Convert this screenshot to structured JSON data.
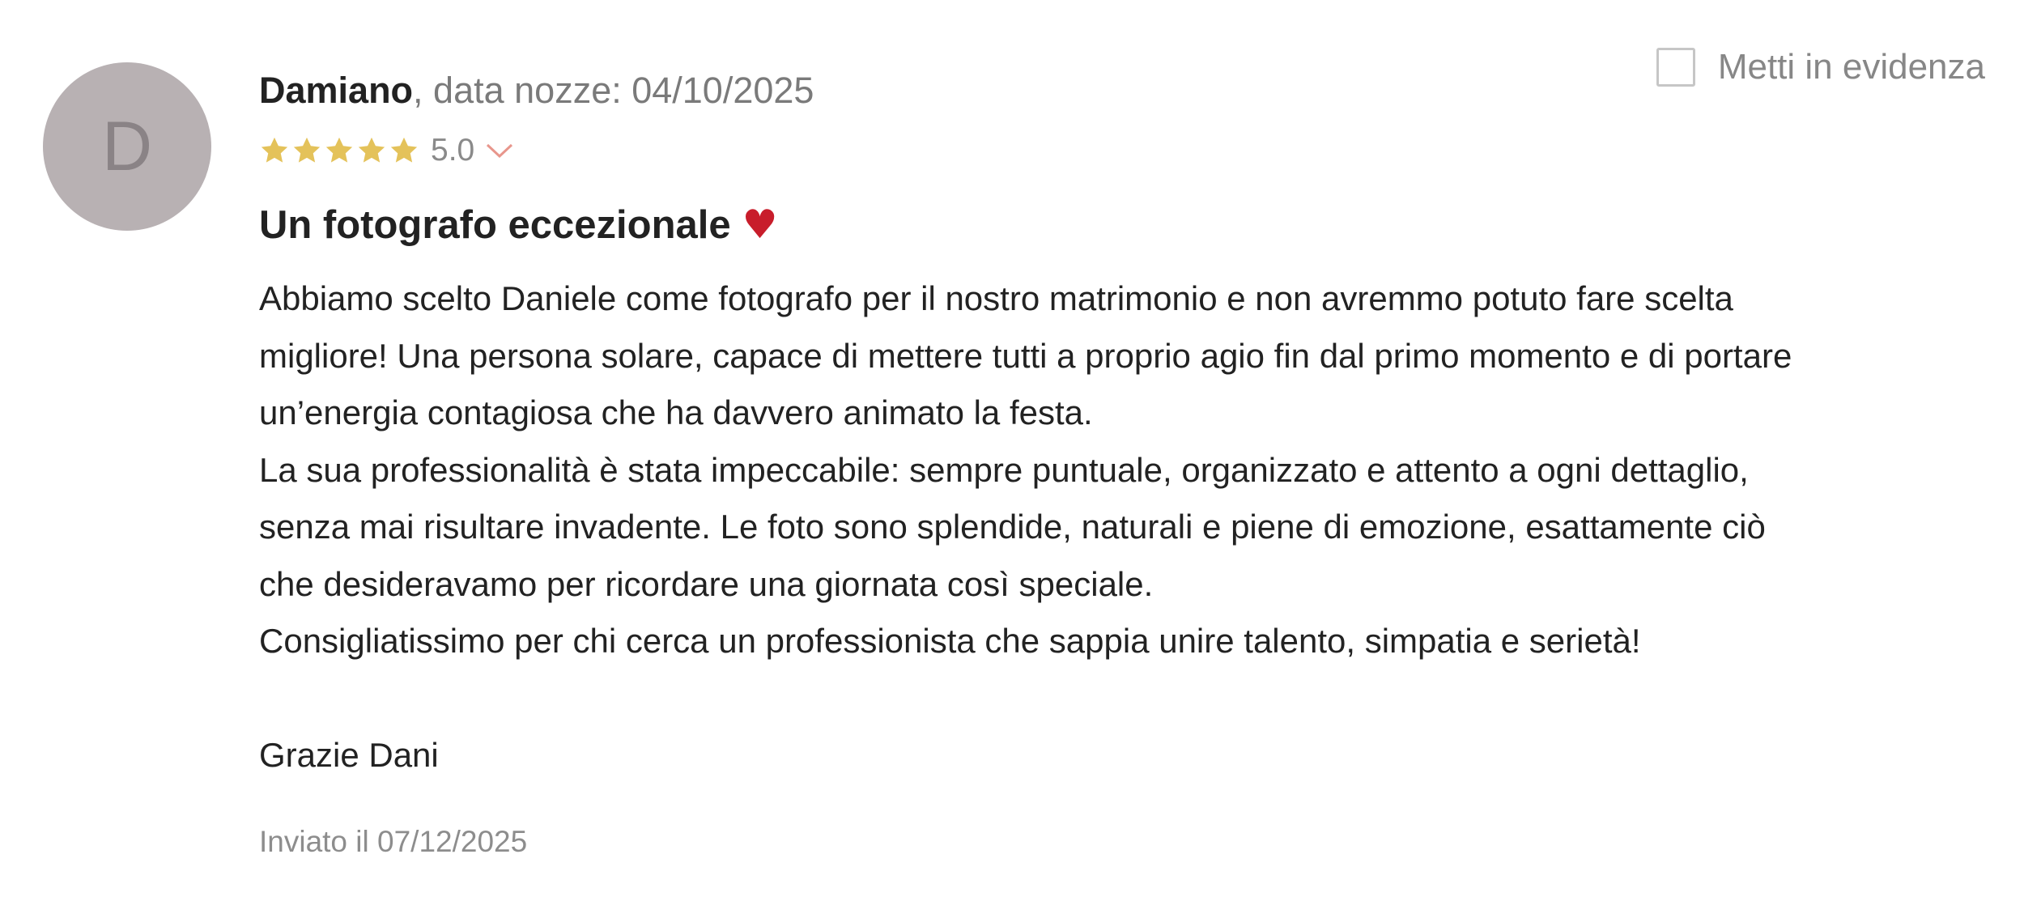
{
  "review": {
    "avatar_initial": "D",
    "author": "Damiano",
    "wedding_date_label": ", data nozze: 04/10/2025",
    "rating": 5.0,
    "rating_text": "5.0",
    "stars": 5,
    "star_color": "#e4c25a",
    "title": "Un fotografo eccezionale",
    "title_emoji": "♥",
    "body": "Abbiamo scelto Daniele come fotografo per il nostro matrimonio e non avremmo potuto fare scelta\nmigliore! Una persona solare, capace di mettere tutti a proprio agio fin dal primo momento e di portare\nun’energia contagiosa che ha davvero animato la festa.\nLa sua professionalità è stata impeccabile: sempre puntuale, organizzato e attento a ogni dettaglio,\nsenza mai risultare invadente. Le foto sono splendide, naturali e piene di emozione, esattamente ciò\nche desideravamo per ricordare una giornata così speciale.\nConsigliatissimo per chi cerca un professionista che sappia unire talento, simpatia e serietà!\n\nGrazie Dani",
    "sent_date": "Inviato il 07/12/2025"
  },
  "feature": {
    "label": "Metti in evidenza",
    "checked": false
  },
  "icons": {
    "star": "star-icon",
    "chevron": "chevron-down-icon",
    "checkbox": "checkbox-icon"
  },
  "colors": {
    "avatar_bg": "#b8b1b3",
    "chevron": "#e8968c",
    "heart": "#c81d2b"
  }
}
